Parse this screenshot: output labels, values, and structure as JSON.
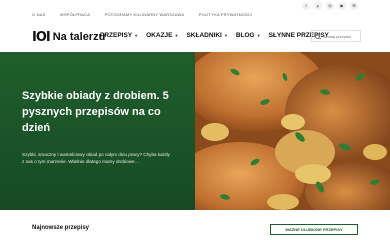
{
  "topbar": {
    "links": [
      "O NAS",
      "WSPÓŁPRACA",
      "POTOGRAMY KULINARNY WARSZAWA",
      "POLITYKA PRYWATNOŚCI"
    ],
    "socials": [
      {
        "name": "facebook",
        "glyph": "f"
      },
      {
        "name": "pinterest",
        "glyph": "p"
      },
      {
        "name": "instagram",
        "glyph": "◎"
      },
      {
        "name": "youtube",
        "glyph": "▶"
      },
      {
        "name": "mail",
        "glyph": "✉"
      }
    ]
  },
  "nav": {
    "logo_mark": "IOI",
    "logo_text": "Na talerzu",
    "menu": [
      {
        "label": "PRZEPISY",
        "has_caret": true
      },
      {
        "label": "OKAZJE",
        "has_caret": true
      },
      {
        "label": "SKŁADNIKI",
        "has_caret": true
      },
      {
        "label": "BLOG",
        "has_caret": true
      },
      {
        "label": "SŁYNNE PRZEPISY",
        "has_caret": false
      }
    ],
    "search_placeholder": "Szukaj przepisu"
  },
  "hero": {
    "title": "Szybkie obiady z drobiem. 5 pysznych przepisów na co dzień",
    "description": "Szybki, smaczny i wartościowy obiad po całym dniu pracy? Chyba każdy z nas o tym marzenie. Właśnie dlatego mamy drobiowe…",
    "bg_color": "#1f5e2c"
  },
  "latest": {
    "heading": "Najnowsze przepisy",
    "see_all_label": "WAŻNE ULUBIONE PRZEPISY"
  },
  "colors": {
    "brand_green": "#1f5e2c",
    "text_dark": "#111111"
  }
}
